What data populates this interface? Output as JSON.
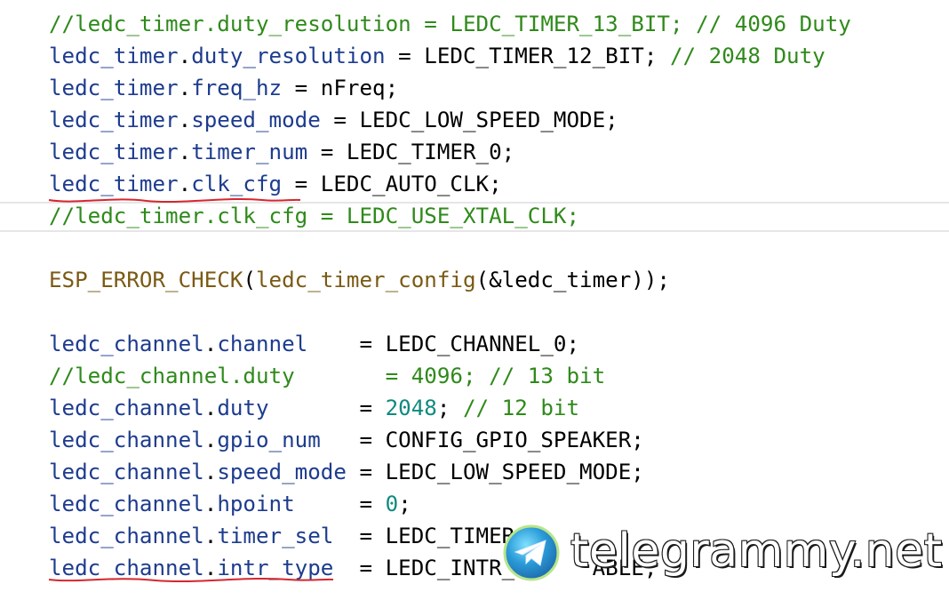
{
  "editor": {
    "lines": [
      {
        "segments": [
          {
            "t": "//ledc_timer.duty_resolution = LEDC_TIMER_13_BIT; // 4096 Duty",
            "c": "comment"
          }
        ]
      },
      {
        "segments": [
          {
            "t": "ledc_timer",
            "c": "fld"
          },
          {
            "t": ".",
            "c": ""
          },
          {
            "t": "duty_resolution",
            "c": "fld"
          },
          {
            "t": " = LEDC_TIMER_12_BIT; ",
            "c": ""
          },
          {
            "t": "// 2048 Duty",
            "c": "comment"
          }
        ]
      },
      {
        "segments": [
          {
            "t": "ledc_timer",
            "c": "fld"
          },
          {
            "t": ".",
            "c": ""
          },
          {
            "t": "freq_hz",
            "c": "fld"
          },
          {
            "t": " = nFreq;",
            "c": ""
          }
        ]
      },
      {
        "segments": [
          {
            "t": "ledc_timer",
            "c": "fld"
          },
          {
            "t": ".",
            "c": ""
          },
          {
            "t": "speed_mode",
            "c": "fld"
          },
          {
            "t": " = LEDC_LOW_SPEED_MODE;",
            "c": ""
          }
        ]
      },
      {
        "segments": [
          {
            "t": "ledc_timer",
            "c": "fld"
          },
          {
            "t": ".",
            "c": ""
          },
          {
            "t": "timer_num",
            "c": "fld"
          },
          {
            "t": " = LEDC_TIMER_0;",
            "c": ""
          }
        ]
      },
      {
        "segments": [
          {
            "t": "ledc_timer",
            "c": "fld"
          },
          {
            "t": ".",
            "c": ""
          },
          {
            "t": "clk_cfg",
            "c": "fld"
          },
          {
            "t": " = LEDC_AUTO_CLK;",
            "c": ""
          }
        ]
      },
      {
        "segments": [
          {
            "t": "//ledc_timer.clk_cfg = LEDC_USE_XTAL_CLK;",
            "c": "comment"
          }
        ]
      },
      {
        "segments": []
      },
      {
        "segments": [
          {
            "t": "ESP_ERROR_CHECK",
            "c": "fn"
          },
          {
            "t": "(",
            "c": ""
          },
          {
            "t": "ledc_timer_config",
            "c": "fn"
          },
          {
            "t": "(&ledc_timer));",
            "c": ""
          }
        ]
      },
      {
        "segments": []
      },
      {
        "segments": [
          {
            "t": "ledc_channel",
            "c": "fld"
          },
          {
            "t": ".",
            "c": ""
          },
          {
            "t": "channel",
            "c": "fld"
          },
          {
            "t": "    = LEDC_CHANNEL_0;",
            "c": ""
          }
        ]
      },
      {
        "segments": [
          {
            "t": "//ledc_channel.duty       = 4096; // 13 bit",
            "c": "comment"
          }
        ]
      },
      {
        "segments": [
          {
            "t": "ledc_channel",
            "c": "fld"
          },
          {
            "t": ".",
            "c": ""
          },
          {
            "t": "duty",
            "c": "fld"
          },
          {
            "t": "       = ",
            "c": ""
          },
          {
            "t": "2048",
            "c": "num"
          },
          {
            "t": "; ",
            "c": ""
          },
          {
            "t": "// 12 bit",
            "c": "comment"
          }
        ]
      },
      {
        "segments": [
          {
            "t": "ledc_channel",
            "c": "fld"
          },
          {
            "t": ".",
            "c": ""
          },
          {
            "t": "gpio_num",
            "c": "fld"
          },
          {
            "t": "   = CONFIG_GPIO_SPEAKER;",
            "c": ""
          }
        ]
      },
      {
        "segments": [
          {
            "t": "ledc_channel",
            "c": "fld"
          },
          {
            "t": ".",
            "c": ""
          },
          {
            "t": "speed_mode",
            "c": "fld"
          },
          {
            "t": " = LEDC_LOW_SPEED_MODE;",
            "c": ""
          }
        ]
      },
      {
        "segments": [
          {
            "t": "ledc_channel",
            "c": "fld"
          },
          {
            "t": ".",
            "c": ""
          },
          {
            "t": "hpoint",
            "c": "fld"
          },
          {
            "t": "     = ",
            "c": ""
          },
          {
            "t": "0",
            "c": "num"
          },
          {
            "t": ";",
            "c": ""
          }
        ]
      },
      {
        "segments": [
          {
            "t": "ledc_channel",
            "c": "fld"
          },
          {
            "t": ".",
            "c": ""
          },
          {
            "t": "timer_sel",
            "c": "fld"
          },
          {
            "t": "  = LEDC_TIMER",
            "c": ""
          }
        ]
      },
      {
        "segments": [
          {
            "t": "ledc_channel",
            "c": "fld"
          },
          {
            "t": ".",
            "c": ""
          },
          {
            "t": "intr_type",
            "c": "fld"
          },
          {
            "t": "  = LEDC_INTR_",
            "c": ""
          },
          {
            "t": "      ",
            "c": ""
          },
          {
            "t": "ABLE;",
            "c": ""
          }
        ]
      }
    ]
  },
  "watermark": {
    "text": "telegrammy.net",
    "icon": "telegram-paper-plane-icon"
  },
  "colors": {
    "comment": "#2f8a1b",
    "function": "#7a5a14",
    "field": "#1d3c8e",
    "number": "#0f8a7f",
    "underline": "#d6262e"
  }
}
